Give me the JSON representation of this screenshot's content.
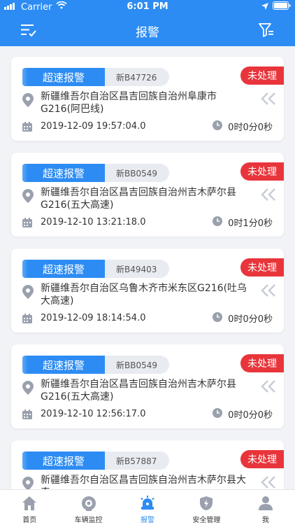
{
  "status_bar": {
    "carrier": "Carrier",
    "time": "6:01 PM"
  },
  "header": {
    "title": "报警"
  },
  "alerts": [
    {
      "type": "超速报警",
      "plate": "新B47726",
      "status": "未处理",
      "address": "新疆维吾尔自治区昌吉回族自治州阜康市G216(阿巴线)",
      "time": "2019-12-09 19:57:04.0",
      "duration": "0时0分0秒"
    },
    {
      "type": "超速报警",
      "plate": "新BB0549",
      "status": "未处理",
      "address": "新疆维吾尔自治区昌吉回族自治州吉木萨尔县G216(五大高速)",
      "time": "2019-12-10 13:21:18.0",
      "duration": "0时1分0秒"
    },
    {
      "type": "超速报警",
      "plate": "新B49403",
      "status": "未处理",
      "address": "新疆维吾尔自治区乌鲁木齐市米东区G216(吐乌大高速)",
      "time": "2019-12-09 18:14:54.0",
      "duration": "0时0分0秒"
    },
    {
      "type": "超速报警",
      "plate": "新BB0549",
      "status": "未处理",
      "address": "新疆维吾尔自治区昌吉回族自治州吉木萨尔县G216(五大高速)",
      "time": "2019-12-10 12:56:17.0",
      "duration": "0时0分0秒"
    },
    {
      "type": "超速报警",
      "plate": "新B57887",
      "status": "未处理",
      "address": "新疆维吾尔自治区昌吉回族自治州吉木萨尔县大奇",
      "time": "",
      "duration": ""
    }
  ],
  "tabs": [
    {
      "label": "首页",
      "icon": "home-icon"
    },
    {
      "label": "车辆监控",
      "icon": "monitor-icon"
    },
    {
      "label": "报警",
      "icon": "alarm-icon"
    },
    {
      "label": "安全管理",
      "icon": "shield-icon"
    },
    {
      "label": "我",
      "icon": "user-icon"
    }
  ],
  "colors": {
    "primary": "#2c8cf4",
    "status_unhandled": "#e8353b",
    "icon_gray": "#9aa0ad"
  }
}
